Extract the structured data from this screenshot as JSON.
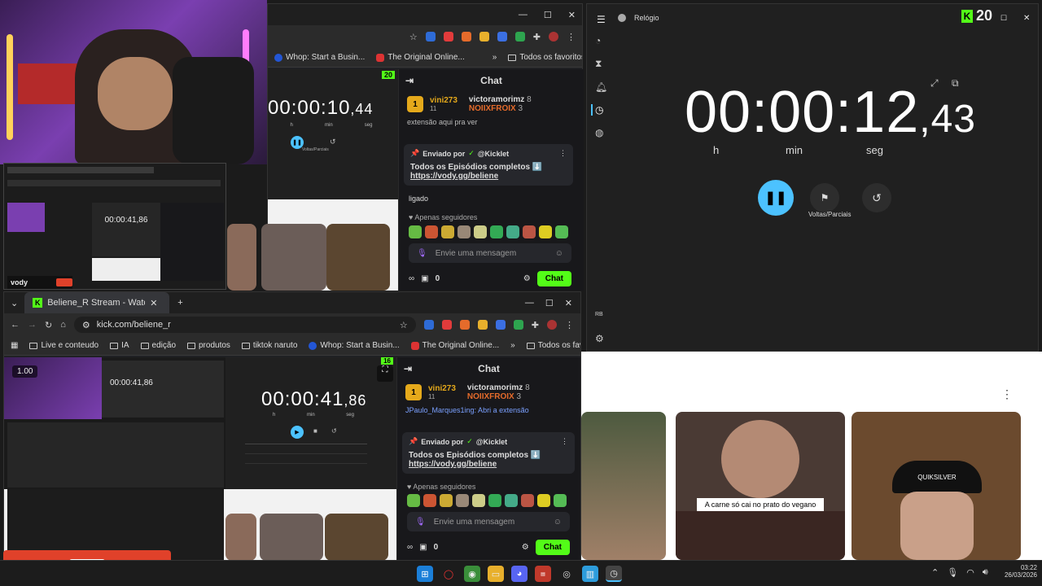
{
  "colors": {
    "accent": "#53fc18",
    "clock_accent": "#4cc2ff",
    "overlay": "#e0412a"
  },
  "top_browser": {
    "bookmarks": [
      {
        "label": "Whop: Start a Busin..."
      },
      {
        "label": "The Original Online..."
      }
    ],
    "all_favorites": "Todos os favoritos",
    "kick_count": "20",
    "timer": {
      "main": "00:00:10",
      "frac": ",44",
      "h": "h",
      "min": "min",
      "seg": "seg",
      "laps_label": "Voltas/Parciais"
    },
    "chat": {
      "title": "Chat",
      "leader1": {
        "rank": "1",
        "name": "vini273",
        "count": "11"
      },
      "leader2": {
        "name": "victoramorimz",
        "count": "8"
      },
      "leader3": {
        "name": "NOIIXFROIX",
        "count": "3"
      },
      "pinned_by_label": "Enviado por",
      "pinned_by": "@Kicklet",
      "pinned_text": "Todos os Episódios completos ⬇️",
      "pinned_link": "https://vody.gg/beliene",
      "peek_line": "extensão aqui pra ver",
      "msg_ligado": "ligado",
      "followers_only": "Apenas seguidores",
      "placeholder": "Envie uma mensagem",
      "points": "0",
      "send": "Chat"
    }
  },
  "bottom_browser": {
    "tab_title": "Beliene_R Stream - Watch Live",
    "url": "kick.com/beliene_r",
    "bookmarks": [
      {
        "label": "Live e conteudo"
      },
      {
        "label": "IA"
      },
      {
        "label": "edição"
      },
      {
        "label": "produtos"
      },
      {
        "label": "tiktok naruto"
      },
      {
        "label": "Whop: Start a Busin..."
      },
      {
        "label": "The Original Online..."
      }
    ],
    "all_favorites": "Todos os favoritos",
    "speed": "1.00",
    "kick_count": "16",
    "timer": {
      "main": "00:00:41",
      "frac": ",86",
      "h": "h",
      "min": "min",
      "seg": "seg"
    },
    "chat": {
      "title": "Chat",
      "leader1": {
        "rank": "1",
        "name": "vini273",
        "count": "11"
      },
      "leader2": {
        "name": "victoramorimz",
        "count": "8"
      },
      "leader3": {
        "name": "NOIIXFROIX",
        "count": "3"
      },
      "peek_line": "JPaulo_Marques1ing: Abri a extensão",
      "pinned_by_label": "Enviado por",
      "pinned_by": "@Kicklet",
      "pinned_text": "Todos os Episódios completos ⬇️",
      "pinned_link": "https://vody.gg/beliene",
      "followers_only": "Apenas seguidores",
      "placeholder": "Envie uma mensagem",
      "points": "0",
      "send": "Chat"
    }
  },
  "clock_app": {
    "title": "Relógio",
    "kick_count": "20",
    "time_main": "00:00:12",
    "time_frac": ",43",
    "h": "h",
    "min": "min",
    "seg": "seg",
    "laps_label": "Voltas/Parciais",
    "initials": "RB"
  },
  "videos": {
    "caption": "A carne só cai no prato do vegano",
    "hat_text": "QUIKSILVER"
  },
  "webcam_brand": "vody",
  "taskbar": {
    "time": "03:22",
    "date": "26/03/2026"
  }
}
